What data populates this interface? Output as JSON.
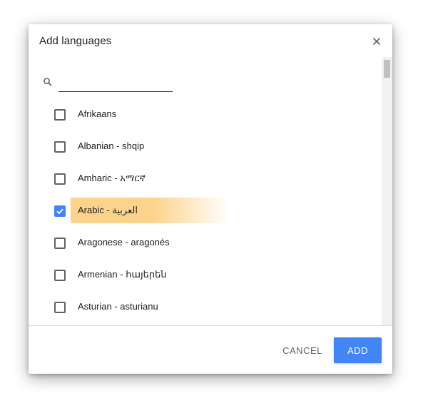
{
  "dialog": {
    "title": "Add languages",
    "close_icon": "close-icon"
  },
  "search": {
    "icon": "search-icon",
    "value": "",
    "placeholder": ""
  },
  "languages": [
    {
      "label": "Afrikaans",
      "checked": false,
      "highlighted": false
    },
    {
      "label": "Albanian - shqip",
      "checked": false,
      "highlighted": false
    },
    {
      "label": "Amharic - አማርኛ",
      "checked": false,
      "highlighted": false
    },
    {
      "label": "Arabic - العربية",
      "checked": true,
      "highlighted": true
    },
    {
      "label": "Aragonese - aragonés",
      "checked": false,
      "highlighted": false
    },
    {
      "label": "Armenian - հայերեն",
      "checked": false,
      "highlighted": false
    },
    {
      "label": "Asturian - asturianu",
      "checked": false,
      "highlighted": false
    }
  ],
  "footer": {
    "cancel_label": "CANCEL",
    "add_label": "ADD"
  },
  "colors": {
    "accent": "#4285f4",
    "highlight": "#fcd38b"
  }
}
